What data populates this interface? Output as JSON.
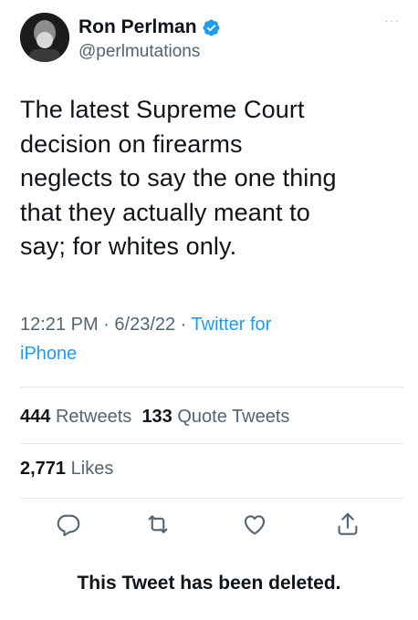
{
  "user": {
    "display_name": "Ron Perlman",
    "handle": "@perlmutations",
    "verified": true
  },
  "tweet": {
    "text_lines": [
      "The latest Supreme Court",
      "decision on firearms",
      "neglects to say the one thing",
      "that they actually meant to",
      "say; for whites only."
    ],
    "time": "12:21 PM",
    "date": "6/23/22",
    "separator": " · ",
    "source_line1": "Twitter for",
    "source_line2": "iPhone"
  },
  "stats": {
    "retweets_count": "444",
    "retweets_label": "Retweets",
    "quotes_count": "133",
    "quotes_label": "Quote Tweets",
    "likes_count": "2,771",
    "likes_label": "Likes"
  },
  "notice": {
    "deleted": "This Tweet has been deleted."
  },
  "colors": {
    "accent": "#1d9bf0",
    "text": "#0f1419",
    "secondary": "#536471",
    "divider": "#e4e7ea"
  }
}
